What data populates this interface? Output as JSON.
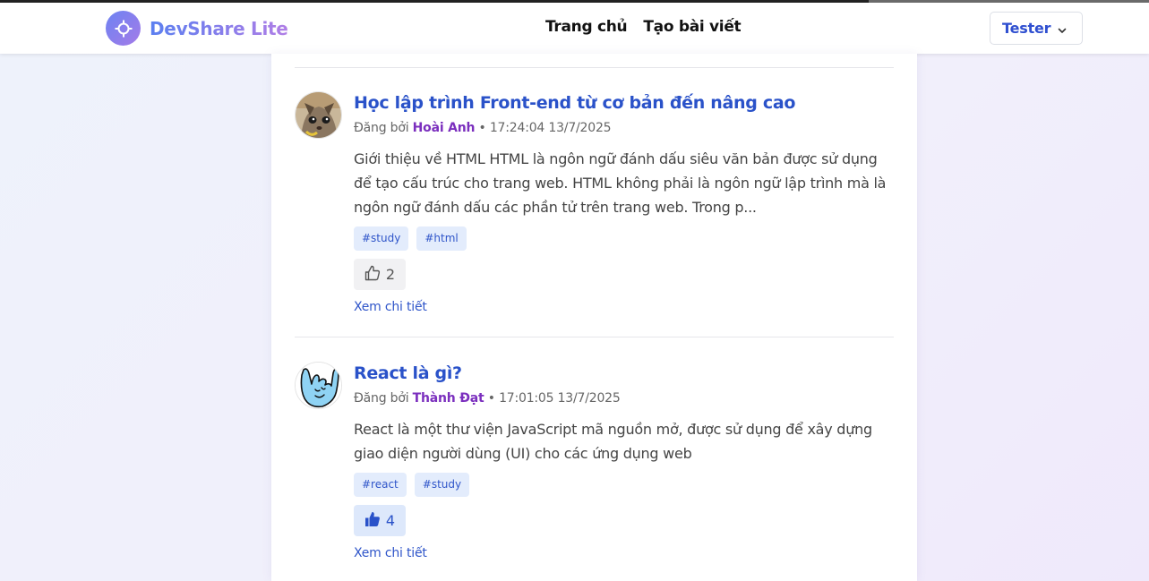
{
  "header": {
    "brand": "DevShare Lite",
    "nav": [
      "Trang chủ",
      "Tạo bài viết"
    ],
    "user": "Tester"
  },
  "posts": [
    {
      "title": "Học lập trình Front-end từ cơ bản đến nâng cao",
      "posted_by": "Đăng bởi",
      "author": "Hoài Anh",
      "time": "• 17:24:04 13/7/2025",
      "excerpt": "Giới thiệu về HTML HTML là ngôn ngữ đánh dấu siêu văn bản được sử dụng để tạo cấu trúc cho trang web. HTML không phải là ngôn ngữ lập trình mà là ngôn ngữ đánh dấu các phần tử trên trang web. Trong p...",
      "tags": [
        "#study",
        "#html"
      ],
      "likes": "2",
      "liked": false,
      "detail": "Xem chi tiết"
    },
    {
      "title": "React là gì?",
      "posted_by": "Đăng bởi",
      "author": "Thành Đạt",
      "time": "• 17:01:05 13/7/2025",
      "excerpt": "React là một thư viện JavaScript mã nguồn mở, được sử dụng để xây dựng giao diện người dùng (UI) cho các ứng dụng web",
      "tags": [
        "#react",
        "#study"
      ],
      "likes": "4",
      "liked": true,
      "detail": "Xem chi tiết"
    }
  ],
  "colors": {
    "accent": "#2a52c9",
    "author": "#7b2fbe",
    "tag_bg": "#e3ecfc"
  }
}
